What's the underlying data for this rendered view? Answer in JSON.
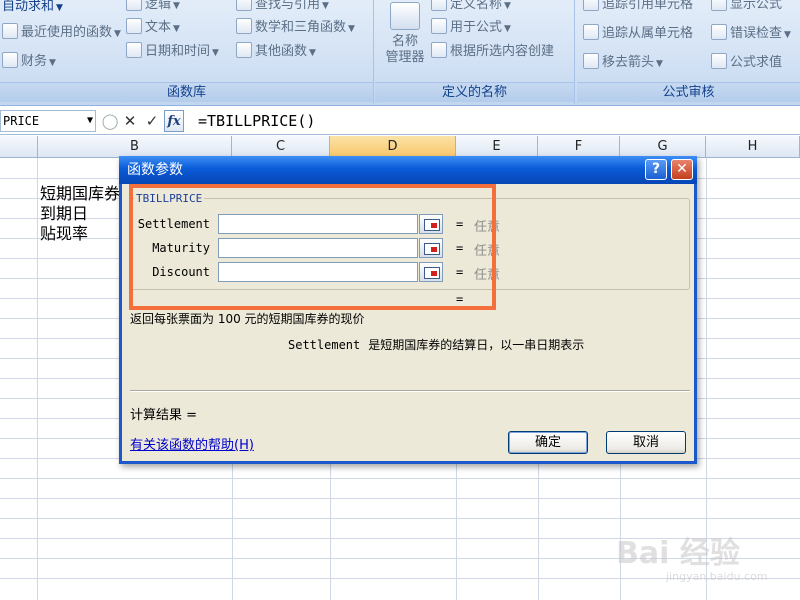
{
  "ribbon": {
    "groups": [
      {
        "title": "函数库",
        "items": [
          "自动求和",
          "最近使用的函数",
          "财务",
          "逻辑",
          "文本",
          "日期和时间",
          "查找与引用",
          "数学和三角函数",
          "其他函数"
        ]
      },
      {
        "title": "定义的名称",
        "big_button": "名称\n管理器",
        "items": [
          "定义名称",
          "用于公式",
          "根据所选内容创建"
        ]
      },
      {
        "title": "公式审核",
        "items": [
          "追踪引用单元格",
          "显示公式",
          "追踪从属单元格",
          "错误检查",
          "移去箭头",
          "公式求值"
        ]
      }
    ]
  },
  "formula_bar": {
    "name_box": "PRICE",
    "formula": "=TBILLPRICE()"
  },
  "grid": {
    "columns": [
      "B",
      "C",
      "D",
      "E",
      "F",
      "G",
      "H"
    ],
    "selected_column": "D",
    "cells": [
      "短期国库券",
      "到期日",
      "贴现率"
    ]
  },
  "dialog": {
    "title": "函数参数",
    "function_name": "TBILLPRICE",
    "args": [
      {
        "label": "Settlement",
        "eq": "=",
        "result": "任意"
      },
      {
        "label": "Maturity",
        "eq": "=",
        "result": "任意"
      },
      {
        "label": "Discount",
        "eq": "=",
        "result": "任意"
      }
    ],
    "total_eq": "=",
    "description": "返回每张票面为 100 元的短期国库券的现价",
    "arg_desc_name": "Settlement",
    "arg_desc_text": "是短期国库券的结算日，以一串日期表示",
    "calc_result": "计算结果 =",
    "help_link": "有关该函数的帮助(H)",
    "ok": "确定",
    "cancel": "取消"
  },
  "watermark": {
    "brand": "Bai 经验",
    "url": "jingyan.baidu.com"
  }
}
